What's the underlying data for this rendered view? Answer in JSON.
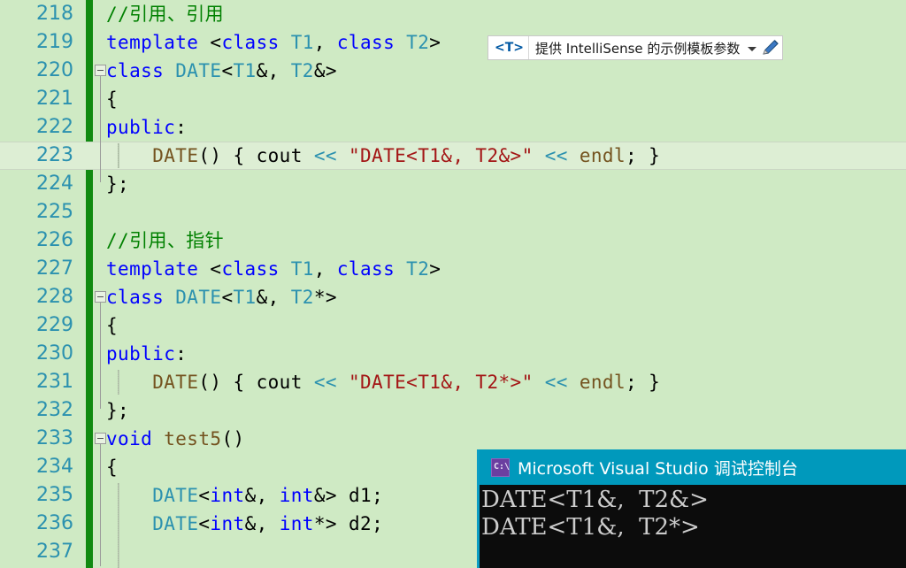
{
  "editor": {
    "first_line_number": 218,
    "colors": {
      "background": "#cfeac4",
      "current_line": "#ddeed4",
      "change_bar": "#108a10",
      "line_number": "#2b91af",
      "keyword": "#0000ff",
      "type": "#2b91af",
      "string": "#a31515",
      "comment": "#008000",
      "function": "#74531f"
    },
    "lines": [
      {
        "num": "218",
        "tokens": [
          {
            "t": "//引用、引用",
            "c": "cmt"
          }
        ]
      },
      {
        "num": "219",
        "tokens": [
          {
            "t": "template ",
            "c": "kw"
          },
          {
            "t": "<",
            "c": "pun"
          },
          {
            "t": "class ",
            "c": "kw"
          },
          {
            "t": "T1",
            "c": "typ"
          },
          {
            "t": ", ",
            "c": "pun"
          },
          {
            "t": "class ",
            "c": "kw"
          },
          {
            "t": "T2",
            "c": "typ"
          },
          {
            "t": ">",
            "c": "pun"
          }
        ]
      },
      {
        "num": "220",
        "tokens": [
          {
            "t": "class ",
            "c": "kw"
          },
          {
            "t": "DATE",
            "c": "typ"
          },
          {
            "t": "<",
            "c": "pun"
          },
          {
            "t": "T1",
            "c": "typ"
          },
          {
            "t": "&, ",
            "c": "pun"
          },
          {
            "t": "T2",
            "c": "typ"
          },
          {
            "t": "&>",
            "c": "pun"
          }
        ]
      },
      {
        "num": "221",
        "tokens": [
          {
            "t": "{",
            "c": "pun"
          }
        ]
      },
      {
        "num": "222",
        "tokens": [
          {
            "t": "public",
            "c": "kw"
          },
          {
            "t": ":",
            "c": "pun"
          }
        ]
      },
      {
        "num": "223",
        "tokens": [
          {
            "t": "    ",
            "c": "pun"
          },
          {
            "t": "DATE",
            "c": "fn"
          },
          {
            "t": "() { ",
            "c": "pun"
          },
          {
            "t": "cout ",
            "c": "pun"
          },
          {
            "t": "<<",
            "c": "typ"
          },
          {
            "t": " ",
            "c": "pun"
          },
          {
            "t": "\"DATE<T1&, T2&>\"",
            "c": "str"
          },
          {
            "t": " ",
            "c": "pun"
          },
          {
            "t": "<<",
            "c": "typ"
          },
          {
            "t": " ",
            "c": "pun"
          },
          {
            "t": "endl",
            "c": "fn"
          },
          {
            "t": "; }",
            "c": "pun"
          }
        ]
      },
      {
        "num": "224",
        "tokens": [
          {
            "t": "};",
            "c": "pun"
          }
        ]
      },
      {
        "num": "225",
        "tokens": []
      },
      {
        "num": "226",
        "tokens": [
          {
            "t": "//引用、指针",
            "c": "cmt"
          }
        ]
      },
      {
        "num": "227",
        "tokens": [
          {
            "t": "template ",
            "c": "kw"
          },
          {
            "t": "<",
            "c": "pun"
          },
          {
            "t": "class ",
            "c": "kw"
          },
          {
            "t": "T1",
            "c": "typ"
          },
          {
            "t": ", ",
            "c": "pun"
          },
          {
            "t": "class ",
            "c": "kw"
          },
          {
            "t": "T2",
            "c": "typ"
          },
          {
            "t": ">",
            "c": "pun"
          }
        ]
      },
      {
        "num": "228",
        "tokens": [
          {
            "t": "class ",
            "c": "kw"
          },
          {
            "t": "DATE",
            "c": "typ"
          },
          {
            "t": "<",
            "c": "pun"
          },
          {
            "t": "T1",
            "c": "typ"
          },
          {
            "t": "&, ",
            "c": "pun"
          },
          {
            "t": "T2",
            "c": "typ"
          },
          {
            "t": "*>",
            "c": "pun"
          }
        ]
      },
      {
        "num": "229",
        "tokens": [
          {
            "t": "{",
            "c": "pun"
          }
        ]
      },
      {
        "num": "230",
        "tokens": [
          {
            "t": "public",
            "c": "kw"
          },
          {
            "t": ":",
            "c": "pun"
          }
        ]
      },
      {
        "num": "231",
        "tokens": [
          {
            "t": "    ",
            "c": "pun"
          },
          {
            "t": "DATE",
            "c": "fn"
          },
          {
            "t": "() { ",
            "c": "pun"
          },
          {
            "t": "cout ",
            "c": "pun"
          },
          {
            "t": "<<",
            "c": "typ"
          },
          {
            "t": " ",
            "c": "pun"
          },
          {
            "t": "\"DATE<T1&, T2*>\"",
            "c": "str"
          },
          {
            "t": " ",
            "c": "pun"
          },
          {
            "t": "<<",
            "c": "typ"
          },
          {
            "t": " ",
            "c": "pun"
          },
          {
            "t": "endl",
            "c": "fn"
          },
          {
            "t": "; }",
            "c": "pun"
          }
        ]
      },
      {
        "num": "232",
        "tokens": [
          {
            "t": "};",
            "c": "pun"
          }
        ]
      },
      {
        "num": "233",
        "tokens": [
          {
            "t": "void ",
            "c": "kw"
          },
          {
            "t": "test5",
            "c": "fn"
          },
          {
            "t": "()",
            "c": "pun"
          }
        ]
      },
      {
        "num": "234",
        "tokens": [
          {
            "t": "{",
            "c": "pun"
          }
        ]
      },
      {
        "num": "235",
        "tokens": [
          {
            "t": "    ",
            "c": "pun"
          },
          {
            "t": "DATE",
            "c": "typ"
          },
          {
            "t": "<",
            "c": "pun"
          },
          {
            "t": "int",
            "c": "kw"
          },
          {
            "t": "&, ",
            "c": "pun"
          },
          {
            "t": "int",
            "c": "kw"
          },
          {
            "t": "&> ",
            "c": "pun"
          },
          {
            "t": "d1;",
            "c": "pun"
          }
        ]
      },
      {
        "num": "236",
        "tokens": [
          {
            "t": "    ",
            "c": "pun"
          },
          {
            "t": "DATE",
            "c": "typ"
          },
          {
            "t": "<",
            "c": "pun"
          },
          {
            "t": "int",
            "c": "kw"
          },
          {
            "t": "&, ",
            "c": "pun"
          },
          {
            "t": "int",
            "c": "kw"
          },
          {
            "t": "*> ",
            "c": "pun"
          },
          {
            "t": "d2;",
            "c": "pun"
          }
        ]
      },
      {
        "num": "237",
        "tokens": []
      }
    ],
    "folds": [
      {
        "line_index": 2
      },
      {
        "line_index": 10
      },
      {
        "line_index": 15
      }
    ],
    "current_line_index": 5
  },
  "template_bar": {
    "symbol": "<T>",
    "text": "提供 IntelliSense 的示例模板参数",
    "caret_icon": "chevron-down-icon",
    "edit_icon": "pencil-icon"
  },
  "console": {
    "icon": "command-prompt-icon",
    "icon_label": "C:\\",
    "title": "Microsoft Visual Studio 调试控制台",
    "output_lines": [
      "DATE<T1&,  T2&>",
      "DATE<T1&,  T2*>"
    ],
    "title_color": "#0099bc",
    "background": "#0c0c0c"
  }
}
